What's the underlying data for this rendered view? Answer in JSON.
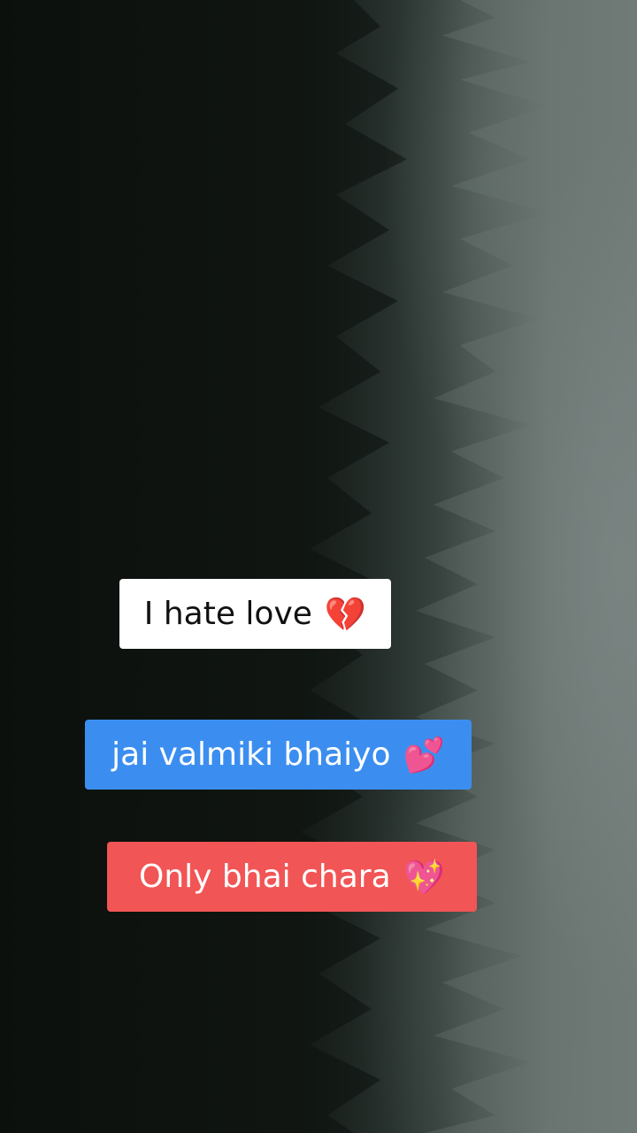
{
  "captions": [
    {
      "text": "I hate love",
      "emoji": "💔",
      "background": "#ffffff",
      "color": "#111111"
    },
    {
      "text": "jai valmiki bhaiyo",
      "emoji": "💕",
      "background": "#3b8ef0",
      "color": "#ffffff"
    },
    {
      "text": "Only bhai chara",
      "emoji": "💖",
      "background": "#f25555",
      "color": "#ffffff"
    }
  ]
}
